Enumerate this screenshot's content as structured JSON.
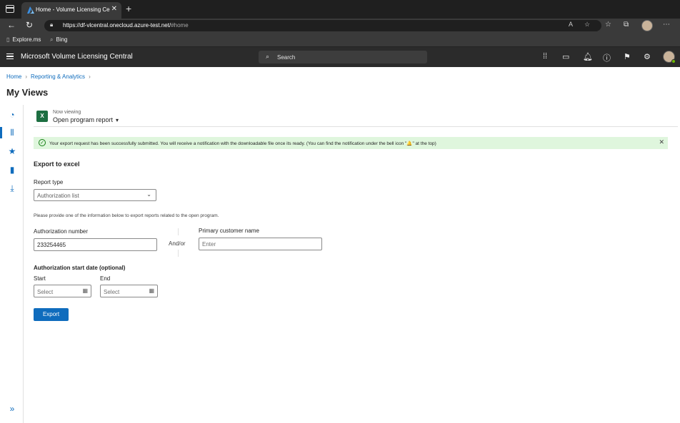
{
  "browser": {
    "tab_title": "Home - Volume Licensing Cen",
    "tab_close": "✕",
    "new_tab": "+",
    "url_host": "https://df-vlcentral.onecloud.azure-test.net/",
    "url_path": "#home",
    "favorites": [
      {
        "icon": "page-icon",
        "label": "Explore.ms"
      },
      {
        "icon": "search-icon",
        "label": "Bing"
      }
    ]
  },
  "app": {
    "title": "Microsoft Volume Licensing Central",
    "search_placeholder": "Search"
  },
  "breadcrumb": [
    "Home",
    "Reporting & Analytics"
  ],
  "page_title": "My Views",
  "now_viewing": {
    "label": "Now viewing",
    "value": "Open program report"
  },
  "banner": {
    "message": "Your export request has been successfully submitted. You will receive a notification with the downloadable file once its ready. (You can find the notification under the bell icon \"🔔\" at the top)"
  },
  "form": {
    "heading": "Export to excel",
    "report_type_label": "Report type",
    "report_type_value": "Authorization list",
    "note": "Please provide one of the information below to export reports related to the open program.",
    "auth_number_label": "Authorization number",
    "auth_number_value": "233254465",
    "and_or": "And/or",
    "primary_customer_label": "Primary customer name",
    "primary_customer_placeholder": "Enter",
    "date_section_label": "Authorization start date (optional)",
    "start_label": "Start",
    "end_label": "End",
    "start_placeholder": "Select",
    "end_placeholder": "Select",
    "export_button": "Export"
  },
  "colors": {
    "brand": "#0f6cbd",
    "success_bg": "#dff6dd",
    "header_bg": "#2b2b2b"
  }
}
